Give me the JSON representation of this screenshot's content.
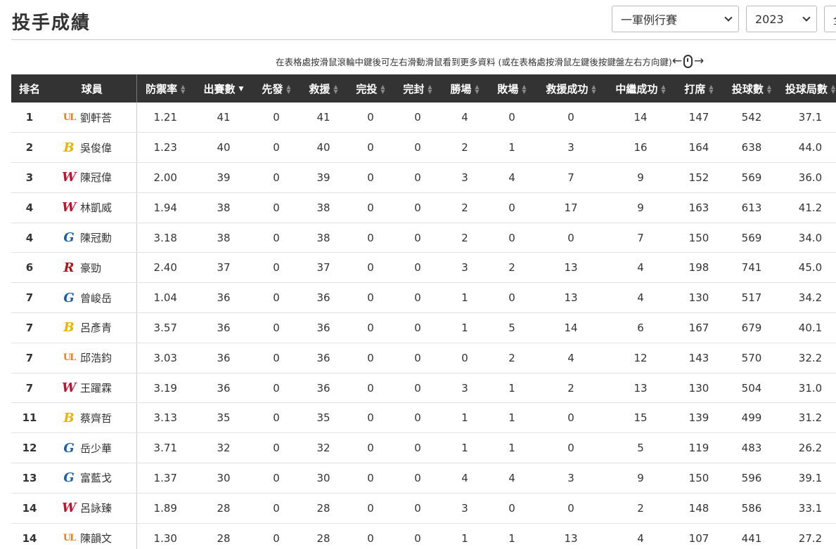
{
  "page_title": "投手成績",
  "filters": {
    "game_type": "一軍例行賽",
    "year": "2023",
    "team": "全"
  },
  "hint": {
    "text": "在表格處按滑鼠滾輪中鍵後可左右滑動滑鼠看到更多資料 (或在表格處按滑鼠左鍵後按鍵盤左右方向鍵)",
    "arrow_left": "←",
    "arrow_right": "→"
  },
  "colors": {
    "header_bg": "#333333",
    "lions": "#e8801a",
    "brothers": "#e8b400",
    "dragons": "#c8102e",
    "guardians": "#1b5fa8",
    "monkeys": "#b5121b"
  },
  "columns": [
    "排名",
    "球員",
    "防禦率",
    "出賽數",
    "先發",
    "救援",
    "完投",
    "完封",
    "勝場",
    "敗場",
    "救援成功",
    "中繼成功",
    "打席",
    "投球數",
    "投球局數"
  ],
  "sort_active": "出賽數",
  "rows": [
    {
      "rank": "1",
      "team_icon": "lions-logo-icon",
      "logo": "UL",
      "name": "劉軒荅",
      "era": "1.21",
      "g": "41",
      "gs": "0",
      "gr": "41",
      "cg": "0",
      "sho": "0",
      "w": "4",
      "l": "0",
      "sv": "0",
      "hld": "14",
      "pa": "147",
      "np": "542",
      "ip": "37.1"
    },
    {
      "rank": "2",
      "team_icon": "brothers-logo-icon",
      "logo": "B",
      "name": "吳俊偉",
      "era": "1.23",
      "g": "40",
      "gs": "0",
      "gr": "40",
      "cg": "0",
      "sho": "0",
      "w": "2",
      "l": "1",
      "sv": "3",
      "hld": "16",
      "pa": "164",
      "np": "638",
      "ip": "44.0"
    },
    {
      "rank": "3",
      "team_icon": "dragons-logo-icon",
      "logo": "W",
      "name": "陳冠偉",
      "era": "2.00",
      "g": "39",
      "gs": "0",
      "gr": "39",
      "cg": "0",
      "sho": "0",
      "w": "3",
      "l": "4",
      "sv": "7",
      "hld": "9",
      "pa": "152",
      "np": "569",
      "ip": "36.0"
    },
    {
      "rank": "4",
      "team_icon": "dragons-logo-icon",
      "logo": "W",
      "name": "林凱威",
      "era": "1.94",
      "g": "38",
      "gs": "0",
      "gr": "38",
      "cg": "0",
      "sho": "0",
      "w": "2",
      "l": "0",
      "sv": "17",
      "hld": "9",
      "pa": "163",
      "np": "613",
      "ip": "41.2"
    },
    {
      "rank": "4",
      "team_icon": "guardians-logo-icon",
      "logo": "G",
      "name": "陳冠勳",
      "era": "3.18",
      "g": "38",
      "gs": "0",
      "gr": "38",
      "cg": "0",
      "sho": "0",
      "w": "2",
      "l": "0",
      "sv": "0",
      "hld": "7",
      "pa": "150",
      "np": "569",
      "ip": "34.0"
    },
    {
      "rank": "6",
      "team_icon": "monkeys-logo-icon",
      "logo": "R",
      "name": "豪勁",
      "era": "2.40",
      "g": "37",
      "gs": "0",
      "gr": "37",
      "cg": "0",
      "sho": "0",
      "w": "3",
      "l": "2",
      "sv": "13",
      "hld": "4",
      "pa": "198",
      "np": "741",
      "ip": "45.0"
    },
    {
      "rank": "7",
      "team_icon": "guardians-logo-icon",
      "logo": "G",
      "name": "曾峻岳",
      "era": "1.04",
      "g": "36",
      "gs": "0",
      "gr": "36",
      "cg": "0",
      "sho": "0",
      "w": "1",
      "l": "0",
      "sv": "13",
      "hld": "4",
      "pa": "130",
      "np": "517",
      "ip": "34.2"
    },
    {
      "rank": "7",
      "team_icon": "brothers-logo-icon",
      "logo": "B",
      "name": "呂彥青",
      "era": "3.57",
      "g": "36",
      "gs": "0",
      "gr": "36",
      "cg": "0",
      "sho": "0",
      "w": "1",
      "l": "5",
      "sv": "14",
      "hld": "6",
      "pa": "167",
      "np": "679",
      "ip": "40.1"
    },
    {
      "rank": "7",
      "team_icon": "lions-logo-icon",
      "logo": "UL",
      "name": "邱浩鈞",
      "era": "3.03",
      "g": "36",
      "gs": "0",
      "gr": "36",
      "cg": "0",
      "sho": "0",
      "w": "0",
      "l": "2",
      "sv": "4",
      "hld": "12",
      "pa": "143",
      "np": "570",
      "ip": "32.2"
    },
    {
      "rank": "7",
      "team_icon": "dragons-logo-icon",
      "logo": "W",
      "name": "王躍霖",
      "era": "3.19",
      "g": "36",
      "gs": "0",
      "gr": "36",
      "cg": "0",
      "sho": "0",
      "w": "3",
      "l": "1",
      "sv": "2",
      "hld": "13",
      "pa": "130",
      "np": "504",
      "ip": "31.0"
    },
    {
      "rank": "11",
      "team_icon": "brothers-logo-icon",
      "logo": "B",
      "name": "蔡齊哲",
      "era": "3.13",
      "g": "35",
      "gs": "0",
      "gr": "35",
      "cg": "0",
      "sho": "0",
      "w": "1",
      "l": "1",
      "sv": "0",
      "hld": "15",
      "pa": "139",
      "np": "499",
      "ip": "31.2"
    },
    {
      "rank": "12",
      "team_icon": "guardians-logo-icon",
      "logo": "G",
      "name": "岳少華",
      "era": "3.71",
      "g": "32",
      "gs": "0",
      "gr": "32",
      "cg": "0",
      "sho": "0",
      "w": "1",
      "l": "1",
      "sv": "0",
      "hld": "5",
      "pa": "119",
      "np": "483",
      "ip": "26.2"
    },
    {
      "rank": "13",
      "team_icon": "guardians-logo-icon",
      "logo": "G",
      "name": "富藍戈",
      "era": "1.37",
      "g": "30",
      "gs": "0",
      "gr": "30",
      "cg": "0",
      "sho": "0",
      "w": "4",
      "l": "4",
      "sv": "3",
      "hld": "9",
      "pa": "150",
      "np": "596",
      "ip": "39.1"
    },
    {
      "rank": "14",
      "team_icon": "dragons-logo-icon",
      "logo": "W",
      "name": "呂詠臻",
      "era": "1.89",
      "g": "28",
      "gs": "0",
      "gr": "28",
      "cg": "0",
      "sho": "0",
      "w": "3",
      "l": "0",
      "sv": "0",
      "hld": "2",
      "pa": "148",
      "np": "586",
      "ip": "33.1"
    },
    {
      "rank": "14",
      "team_icon": "lions-logo-icon",
      "logo": "UL",
      "name": "陳韻文",
      "era": "1.30",
      "g": "28",
      "gs": "0",
      "gr": "28",
      "cg": "0",
      "sho": "0",
      "w": "1",
      "l": "1",
      "sv": "13",
      "hld": "4",
      "pa": "107",
      "np": "441",
      "ip": "27.2"
    }
  ]
}
